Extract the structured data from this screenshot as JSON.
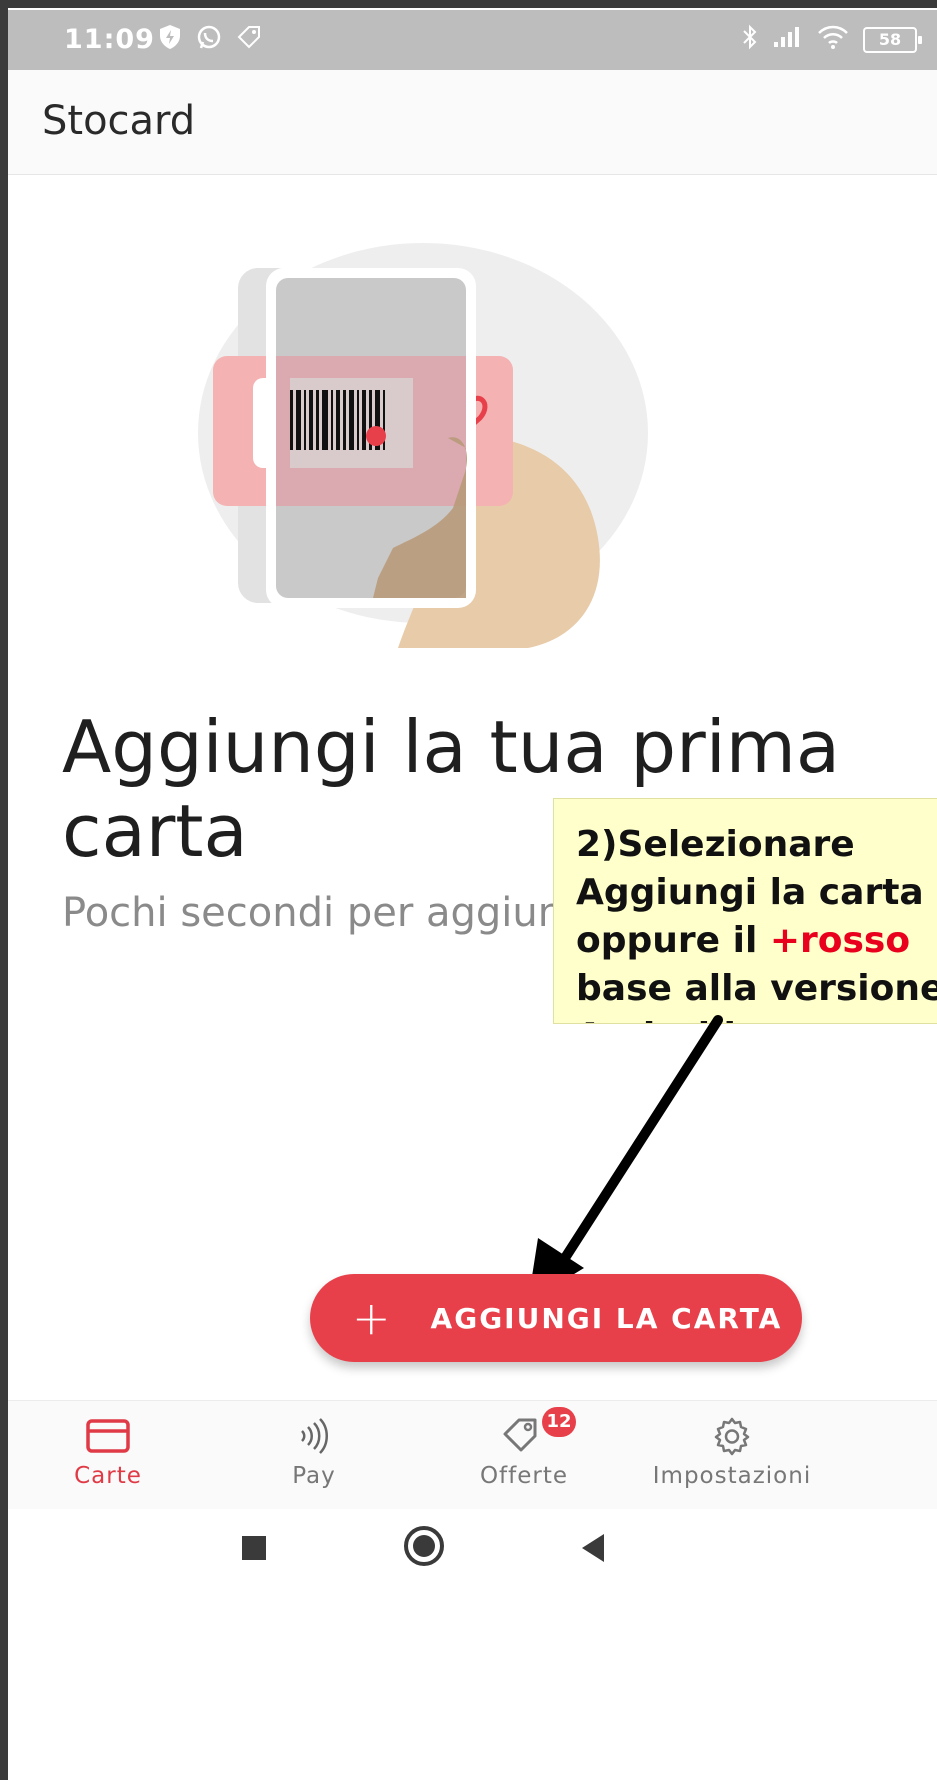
{
  "statusbar": {
    "time": "11:09",
    "battery": "58",
    "left_icons": [
      "shield-icon",
      "whatsapp-icon",
      "tag-icon"
    ],
    "right_icons": [
      "bluetooth-icon",
      "signal-icon",
      "wifi-icon",
      "battery-icon"
    ]
  },
  "appbar": {
    "title": "Stocard"
  },
  "empty_state": {
    "headline": "Aggiungi la tua prima carta",
    "subtitle": "Pochi secondi per aggiungere le carte!"
  },
  "callout": {
    "line1": "2)Selezionare",
    "line2": "Aggiungi la carta",
    "line3_prefix": "oppure il ",
    "line3_red": "+rosso",
    "line4": "base alla versione",
    "line5": "Android",
    "line5_suffix": "."
  },
  "fab": {
    "icon": "plus-icon",
    "label": "AGGIUNGI LA CARTA"
  },
  "bottom_nav": {
    "items": [
      {
        "label": "Carte",
        "icon": "card-icon",
        "active": true
      },
      {
        "label": "Pay",
        "icon": "nfc-icon",
        "active": false
      },
      {
        "label": "Offerte",
        "icon": "tag-icon",
        "badge": "12",
        "active": false
      },
      {
        "label": "Impostazioni",
        "icon": "gear-icon",
        "active": false
      }
    ]
  },
  "colors": {
    "accent": "#e8404a",
    "statusbar": "#bdbdbd",
    "callout_bg": "#ffffcc",
    "callout_red": "#e8001d"
  }
}
